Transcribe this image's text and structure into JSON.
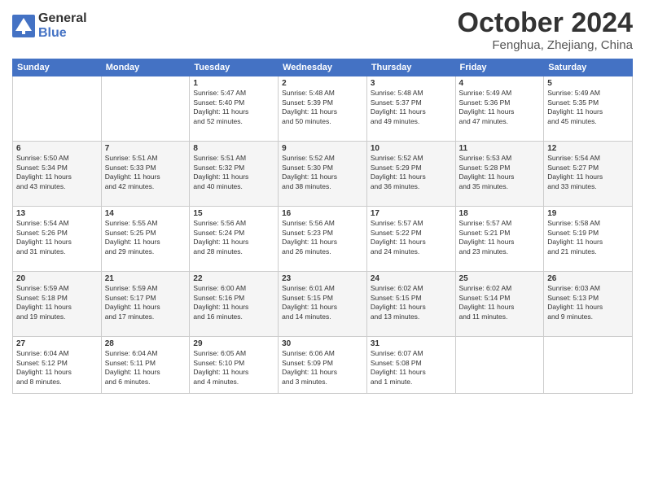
{
  "header": {
    "logo_general": "General",
    "logo_blue": "Blue",
    "month_title": "October 2024",
    "subtitle": "Fenghua, Zhejiang, China"
  },
  "weekdays": [
    "Sunday",
    "Monday",
    "Tuesday",
    "Wednesday",
    "Thursday",
    "Friday",
    "Saturday"
  ],
  "weeks": [
    [
      {
        "day": "",
        "content": ""
      },
      {
        "day": "",
        "content": ""
      },
      {
        "day": "1",
        "content": "Sunrise: 5:47 AM\nSunset: 5:40 PM\nDaylight: 11 hours\nand 52 minutes."
      },
      {
        "day": "2",
        "content": "Sunrise: 5:48 AM\nSunset: 5:39 PM\nDaylight: 11 hours\nand 50 minutes."
      },
      {
        "day": "3",
        "content": "Sunrise: 5:48 AM\nSunset: 5:37 PM\nDaylight: 11 hours\nand 49 minutes."
      },
      {
        "day": "4",
        "content": "Sunrise: 5:49 AM\nSunset: 5:36 PM\nDaylight: 11 hours\nand 47 minutes."
      },
      {
        "day": "5",
        "content": "Sunrise: 5:49 AM\nSunset: 5:35 PM\nDaylight: 11 hours\nand 45 minutes."
      }
    ],
    [
      {
        "day": "6",
        "content": "Sunrise: 5:50 AM\nSunset: 5:34 PM\nDaylight: 11 hours\nand 43 minutes."
      },
      {
        "day": "7",
        "content": "Sunrise: 5:51 AM\nSunset: 5:33 PM\nDaylight: 11 hours\nand 42 minutes."
      },
      {
        "day": "8",
        "content": "Sunrise: 5:51 AM\nSunset: 5:32 PM\nDaylight: 11 hours\nand 40 minutes."
      },
      {
        "day": "9",
        "content": "Sunrise: 5:52 AM\nSunset: 5:30 PM\nDaylight: 11 hours\nand 38 minutes."
      },
      {
        "day": "10",
        "content": "Sunrise: 5:52 AM\nSunset: 5:29 PM\nDaylight: 11 hours\nand 36 minutes."
      },
      {
        "day": "11",
        "content": "Sunrise: 5:53 AM\nSunset: 5:28 PM\nDaylight: 11 hours\nand 35 minutes."
      },
      {
        "day": "12",
        "content": "Sunrise: 5:54 AM\nSunset: 5:27 PM\nDaylight: 11 hours\nand 33 minutes."
      }
    ],
    [
      {
        "day": "13",
        "content": "Sunrise: 5:54 AM\nSunset: 5:26 PM\nDaylight: 11 hours\nand 31 minutes."
      },
      {
        "day": "14",
        "content": "Sunrise: 5:55 AM\nSunset: 5:25 PM\nDaylight: 11 hours\nand 29 minutes."
      },
      {
        "day": "15",
        "content": "Sunrise: 5:56 AM\nSunset: 5:24 PM\nDaylight: 11 hours\nand 28 minutes."
      },
      {
        "day": "16",
        "content": "Sunrise: 5:56 AM\nSunset: 5:23 PM\nDaylight: 11 hours\nand 26 minutes."
      },
      {
        "day": "17",
        "content": "Sunrise: 5:57 AM\nSunset: 5:22 PM\nDaylight: 11 hours\nand 24 minutes."
      },
      {
        "day": "18",
        "content": "Sunrise: 5:57 AM\nSunset: 5:21 PM\nDaylight: 11 hours\nand 23 minutes."
      },
      {
        "day": "19",
        "content": "Sunrise: 5:58 AM\nSunset: 5:19 PM\nDaylight: 11 hours\nand 21 minutes."
      }
    ],
    [
      {
        "day": "20",
        "content": "Sunrise: 5:59 AM\nSunset: 5:18 PM\nDaylight: 11 hours\nand 19 minutes."
      },
      {
        "day": "21",
        "content": "Sunrise: 5:59 AM\nSunset: 5:17 PM\nDaylight: 11 hours\nand 17 minutes."
      },
      {
        "day": "22",
        "content": "Sunrise: 6:00 AM\nSunset: 5:16 PM\nDaylight: 11 hours\nand 16 minutes."
      },
      {
        "day": "23",
        "content": "Sunrise: 6:01 AM\nSunset: 5:15 PM\nDaylight: 11 hours\nand 14 minutes."
      },
      {
        "day": "24",
        "content": "Sunrise: 6:02 AM\nSunset: 5:15 PM\nDaylight: 11 hours\nand 13 minutes."
      },
      {
        "day": "25",
        "content": "Sunrise: 6:02 AM\nSunset: 5:14 PM\nDaylight: 11 hours\nand 11 minutes."
      },
      {
        "day": "26",
        "content": "Sunrise: 6:03 AM\nSunset: 5:13 PM\nDaylight: 11 hours\nand 9 minutes."
      }
    ],
    [
      {
        "day": "27",
        "content": "Sunrise: 6:04 AM\nSunset: 5:12 PM\nDaylight: 11 hours\nand 8 minutes."
      },
      {
        "day": "28",
        "content": "Sunrise: 6:04 AM\nSunset: 5:11 PM\nDaylight: 11 hours\nand 6 minutes."
      },
      {
        "day": "29",
        "content": "Sunrise: 6:05 AM\nSunset: 5:10 PM\nDaylight: 11 hours\nand 4 minutes."
      },
      {
        "day": "30",
        "content": "Sunrise: 6:06 AM\nSunset: 5:09 PM\nDaylight: 11 hours\nand 3 minutes."
      },
      {
        "day": "31",
        "content": "Sunrise: 6:07 AM\nSunset: 5:08 PM\nDaylight: 11 hours\nand 1 minute."
      },
      {
        "day": "",
        "content": ""
      },
      {
        "day": "",
        "content": ""
      }
    ]
  ]
}
